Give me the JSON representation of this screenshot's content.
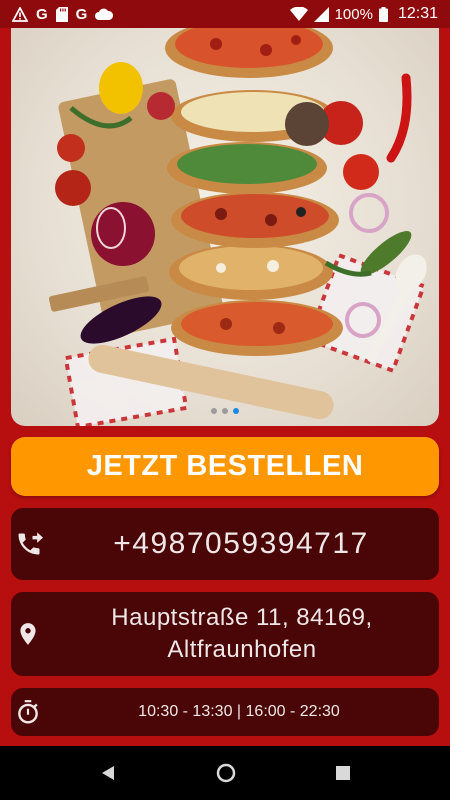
{
  "status_bar": {
    "left_icons": [
      "alert-triangle-icon",
      "google-icon",
      "sd-card-icon",
      "google-icon",
      "cloud-icon"
    ],
    "google_letter": "G",
    "battery": "100%",
    "time": "12:31"
  },
  "hero": {
    "image": "pizza-stack-with-ingredients",
    "slide_count": 3,
    "active_slide": 3
  },
  "order_button": {
    "label": "JETZT BESTELLEN"
  },
  "contact": {
    "phone": "+4987059394717",
    "address_line1": "Hauptstraße 11, 84169,",
    "address_line2": "Altfraunhofen",
    "hours": "10:30 - 13:30 | 16:00 - 22:30"
  },
  "colors": {
    "background": "#b70e10",
    "card": "#4a0507",
    "button": "#ff9800",
    "active_dot": "#1e88e5"
  }
}
